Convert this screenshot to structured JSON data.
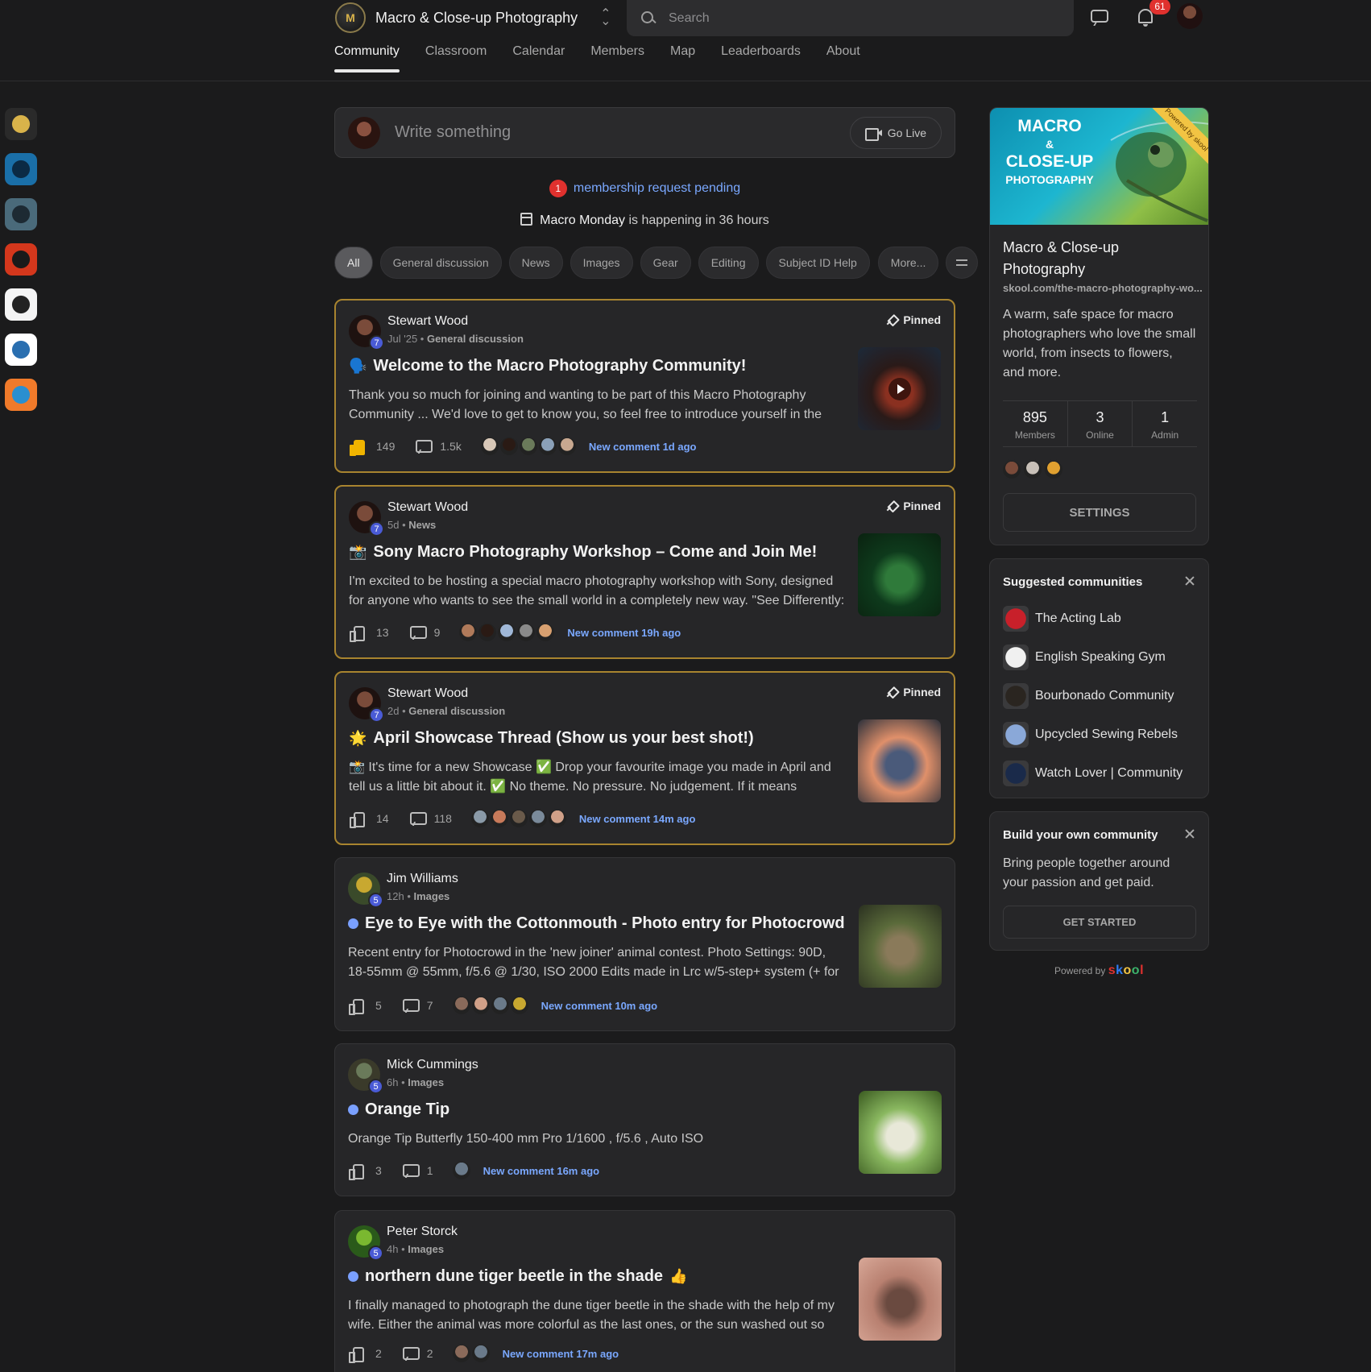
{
  "header": {
    "community_name": "Macro & Close-up Photography",
    "switch_glyph": "⌃⌄",
    "search_placeholder": "Search",
    "notifications_count": "61"
  },
  "tabs": [
    "Community",
    "Classroom",
    "Calendar",
    "Members",
    "Map",
    "Leaderboards",
    "About"
  ],
  "active_tab": "Community",
  "rail": [
    {
      "name": "macro-photography",
      "colors": [
        "#2a2a2a",
        "#d9b34a"
      ]
    },
    {
      "name": "camera-community",
      "colors": [
        "#1a6fa8",
        "#0b2a44"
      ]
    },
    {
      "name": "globe-community",
      "colors": [
        "#4a6a7a",
        "#1d2a33"
      ]
    },
    {
      "name": "orange-swirl-community",
      "colors": [
        "#d4371c",
        "#1a1a1a"
      ]
    },
    {
      "name": "white-badge-community",
      "colors": [
        "#f4f4f4",
        "#222222"
      ]
    },
    {
      "name": "blue-logo-community",
      "colors": [
        "#ffffff",
        "#2a6fb0"
      ]
    },
    {
      "name": "people-community",
      "colors": [
        "#f07a2a",
        "#2a8fd0"
      ]
    }
  ],
  "composer": {
    "placeholder": "Write something",
    "go_live": "Go Live"
  },
  "notice": {
    "pending_count": "1",
    "pending_text": "membership request pending",
    "event_name": "Macro Monday",
    "event_suffix": "is happening in 36 hours"
  },
  "filters": [
    "All",
    "General discussion",
    "News",
    "Images",
    "Gear",
    "Editing",
    "Subject ID Help",
    "More..."
  ],
  "pinned_label": "Pinned",
  "posts": [
    {
      "author": "Stewart Wood",
      "level": "7",
      "time": "Jul '25",
      "category": "General discussion",
      "pinned": true,
      "emoji": "🗣️",
      "title": "Welcome to the Macro Photography Community!",
      "body": "Thank you so much for joining and wanting to be part of this Macro Photography Community ... We'd love to get to know you, so feel free to introduce yourself in the",
      "likes": "149",
      "comments": "1.5k",
      "liked": true,
      "new_comment": "New comment 1d ago",
      "avatar_colors": [
        "#7a4b3a",
        "#1e1210"
      ],
      "face_colors": [
        "#d8c8b8",
        "#2a1a14",
        "#6a7a5a",
        "#8aa0b8",
        "#c8a890"
      ],
      "thumb_colors": [
        "#2a1a18",
        "#8a3020",
        "#1c2a3a"
      ]
    },
    {
      "author": "Stewart Wood",
      "level": "7",
      "time": "5d",
      "category": "News",
      "pinned": true,
      "emoji": "📸",
      "title": "Sony Macro Photography Workshop – Come and Join Me!",
      "body": "I'm excited to be hosting a special macro photography workshop with Sony, designed for anyone who wants to see the small world in a completely new way. \"See Differently:",
      "likes": "13",
      "comments": "9",
      "liked": false,
      "new_comment": "New comment 19h ago",
      "avatar_colors": [
        "#7a4b3a",
        "#1e1210"
      ],
      "face_colors": [
        "#b07a5a",
        "#2a1a14",
        "#a0b8d8",
        "#8a8a8a",
        "#d8a070"
      ],
      "thumb_colors": [
        "#0e3a1c",
        "#2f7a3a",
        "#0a2210"
      ]
    },
    {
      "author": "Stewart Wood",
      "level": "7",
      "time": "2d",
      "category": "General discussion",
      "pinned": true,
      "emoji": "🌟",
      "title": "April Showcase Thread (Show us your best shot!)",
      "body": "📸 It's time for a new Showcase ✅ Drop your favourite image you made in April and tell us a little bit about it. ✅ No theme. No pressure. No judgement. If it means",
      "likes": "14",
      "comments": "118",
      "liked": false,
      "new_comment": "New comment 14m ago",
      "avatar_colors": [
        "#7a4b3a",
        "#1e1210"
      ],
      "face_colors": [
        "#8a9aa8",
        "#c87a5a",
        "#6a5a4a",
        "#7a8a9a",
        "#d0a088"
      ],
      "thumb_colors": [
        "#e0906a",
        "#4a5a7a",
        "#2a2f3a"
      ]
    },
    {
      "author": "Jim Williams",
      "level": "5",
      "time": "12h",
      "category": "Images",
      "pinned": false,
      "emoji": "",
      "title": "Eye to Eye with the Cottonmouth - Photo entry for Photocrowd",
      "body": "Recent entry for Photocrowd in the 'new joiner' animal contest. Photo Settings: 90D, 18-55mm @ 55mm, f/5.6 @ 1/30, ISO 2000 Edits made in Lrc w/5-step+ system (+ for",
      "likes": "5",
      "comments": "7",
      "liked": false,
      "new_comment": "New comment 10m ago",
      "avatar_colors": [
        "#c8a830",
        "#3a4a2a"
      ],
      "face_colors": [
        "#8a6a5a",
        "#d0a088",
        "#6a7a8a",
        "#c8a830"
      ],
      "thumb_colors": [
        "#5a6a3a",
        "#8a7a5a",
        "#2a3020"
      ]
    },
    {
      "author": "Mick Cummings",
      "level": "5",
      "time": "6h",
      "category": "Images",
      "pinned": false,
      "emoji": "",
      "title": "Orange Tip",
      "body": "Orange Tip Butterfly 150-400 mm Pro 1/1600 , f/5.6 , Auto ISO",
      "likes": "3",
      "comments": "1",
      "liked": false,
      "new_comment": "New comment 16m ago",
      "avatar_colors": [
        "#6a7a5a",
        "#3a3a2a"
      ],
      "face_colors": [
        "#6a7a8a"
      ],
      "thumb_colors": [
        "#8ab860",
        "#e8e8d8",
        "#3a5a20"
      ]
    },
    {
      "author": "Peter Storck",
      "level": "5",
      "time": "4h",
      "category": "Images",
      "pinned": false,
      "emoji": "👍",
      "title": "northern dune tiger beetle in the shade",
      "body": "I finally managed to photograph the dune tiger beetle in the shade with the help of my wife. Either the animal was more colorful as the last ones, or the sun washed out so",
      "likes": "2",
      "comments": "2",
      "liked": false,
      "new_comment": "New comment 17m ago",
      "avatar_colors": [
        "#7ab830",
        "#2a5a1a"
      ],
      "face_colors": [
        "#8a6a5a",
        "#6a7a8a"
      ],
      "thumb_colors": [
        "#b88070",
        "#6a4a40",
        "#d8a898"
      ]
    }
  ],
  "about": {
    "banner_line1": "MACRO",
    "banner_amp": "&",
    "banner_line2": "CLOSE-UP",
    "banner_line3": "PHOTOGRAPHY",
    "banner_ribbon": "Powered by skool",
    "title": "Macro & Close-up Photography",
    "url": "skool.com/the-macro-photography-wo...",
    "description": "A warm, safe space for macro photographers who love the small world, from insects to flowers, and more.",
    "stats": [
      {
        "value": "895",
        "label": "Members"
      },
      {
        "value": "3",
        "label": "Online"
      },
      {
        "value": "1",
        "label": "Admin"
      }
    ],
    "face_colors": [
      "#7a4b3a",
      "#c8c0b8",
      "#e0a030"
    ],
    "settings_label": "SETTINGS"
  },
  "suggested": {
    "heading": "Suggested communities",
    "items": [
      {
        "name": "The Acting Lab",
        "color": "#c8202a"
      },
      {
        "name": "English Speaking Gym",
        "color": "#f0f0f0"
      },
      {
        "name": "Bourbonado Community",
        "color": "#2a2520"
      },
      {
        "name": "Upcycled Sewing Rebels",
        "color": "#8aa8d8"
      },
      {
        "name": "Watch Lover | Community",
        "color": "#1a2a4a"
      }
    ]
  },
  "build": {
    "heading": "Build your own community",
    "description": "Bring people together around your passion and get paid.",
    "button": "GET STARTED"
  },
  "powered": {
    "label": "Powered by",
    "brand": "skool"
  }
}
